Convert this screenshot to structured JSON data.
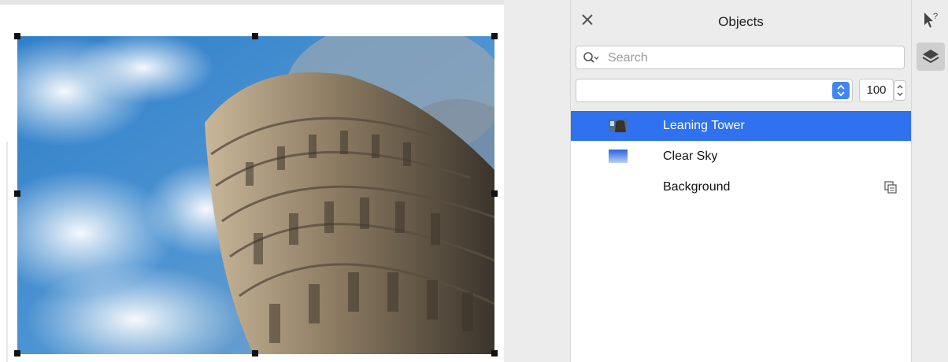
{
  "panel": {
    "title": "Objects",
    "close_icon": "close-icon",
    "search": {
      "placeholder": "Search",
      "value": ""
    },
    "blend_mode": {
      "value": ""
    },
    "opacity": "100"
  },
  "layers": [
    {
      "name": "Leaning Tower",
      "selected": true,
      "thumb": "photo-thumb"
    },
    {
      "name": "Clear Sky",
      "selected": false,
      "thumb": "gradient-thumb"
    },
    {
      "name": "Background",
      "selected": false,
      "thumb": "none",
      "flag_icon": "locked-page-icon"
    }
  ],
  "rail": {
    "icons": [
      "context-help-icon",
      "layers-icon"
    ],
    "active": "layers-icon"
  },
  "colors": {
    "selection": "#2f71ee",
    "panel_bg": "#ececec",
    "accent_stepper": "#3f86f1"
  }
}
